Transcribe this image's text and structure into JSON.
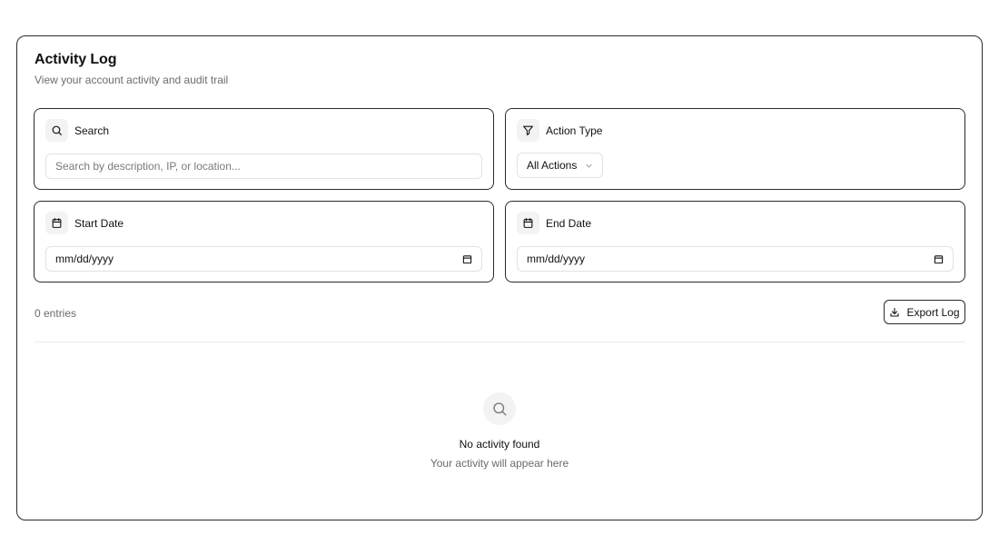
{
  "header": {
    "title": "Activity Log",
    "subtitle": "View your account activity and audit trail"
  },
  "filters": {
    "search": {
      "label": "Search",
      "icon": "search-icon",
      "placeholder": "Search by description, IP, or location...",
      "value": ""
    },
    "action_type": {
      "label": "Action Type",
      "icon": "filter-icon",
      "selected": "All Actions"
    },
    "start_date": {
      "label": "Start Date",
      "icon": "calendar-icon",
      "value": "mm/dd/yyyy"
    },
    "end_date": {
      "label": "End Date",
      "icon": "calendar-icon",
      "value": "mm/dd/yyyy"
    }
  },
  "toolbar": {
    "entries_text": "0 entries",
    "export_label": "Export Log",
    "export_icon": "download-icon"
  },
  "empty_state": {
    "icon": "search-icon",
    "title": "No activity found",
    "subtitle": "Your activity will appear here"
  },
  "colors": {
    "border": "#2a2a2a",
    "muted_text": "#6b6b6b",
    "icon_bg": "#f3f3f3"
  }
}
